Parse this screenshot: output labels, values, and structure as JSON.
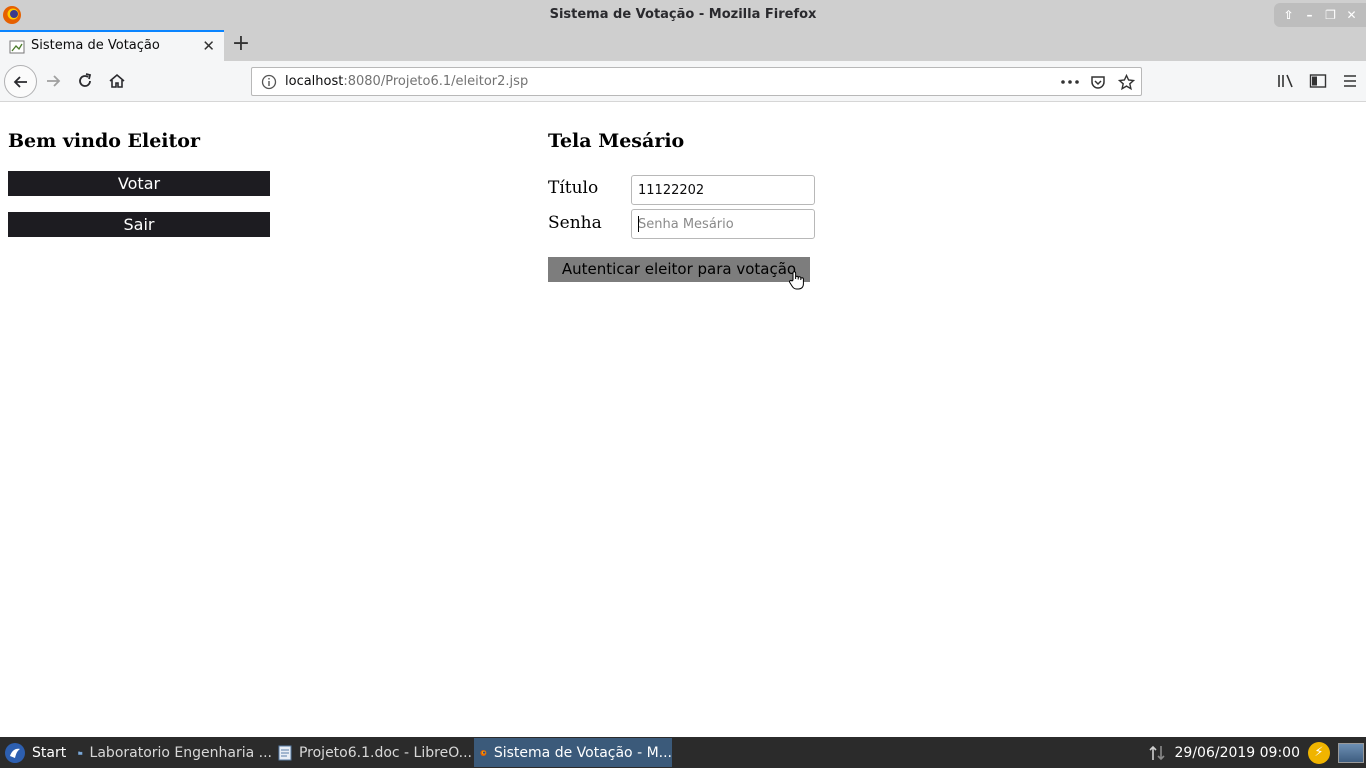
{
  "window": {
    "title": "Sistema de Votação - Mozilla Firefox"
  },
  "tabs": [
    {
      "label": "Sistema de Votação",
      "active": true
    }
  ],
  "urlbar": {
    "host": "localhost",
    "rest": ":8080/Projeto6.1/eleitor2.jsp"
  },
  "eleitor": {
    "heading": "Bem vindo Eleitor",
    "votar_label": "Votar",
    "sair_label": "Sair"
  },
  "mesario": {
    "heading": "Tela Mesário",
    "titulo_label": "Título",
    "titulo_value": "11122202",
    "senha_label": "Senha",
    "senha_placeholder": "Senha Mesário",
    "auth_label": "Autenticar eleitor para votação"
  },
  "taskbar": {
    "start_label": "Start",
    "tasks": [
      {
        "label": "Laboratorio Engenharia ...",
        "icon": "folder-icon"
      },
      {
        "label": "Projeto6.1.doc - LibreO...",
        "icon": "document-icon"
      },
      {
        "label": "Sistema de Votação - M...",
        "icon": "firefox-icon",
        "active": true
      }
    ],
    "clock": "29/06/2019 09:00"
  },
  "colors": {
    "dark_button": "#1d1c21",
    "auth_button": "#7d7d7d",
    "tab_accent": "#0a84ff",
    "taskbar": "#2b2b2b"
  }
}
